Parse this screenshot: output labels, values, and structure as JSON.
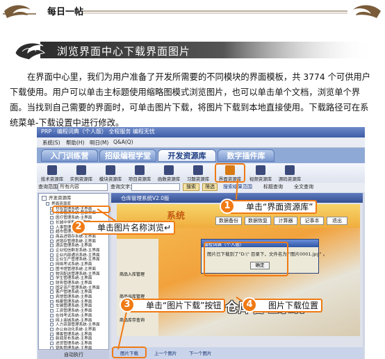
{
  "header": {
    "title": "每日一帖"
  },
  "banner": {
    "title": "浏览界面中心下载界面图片"
  },
  "paragraph": "在界面中心里，我们为用户准备了开发所需要的不同模块的界面模板，共 3774 个可供用户下载使用。用户可以单击主标题使用缩略图模式浏览图片，也可以单击单个文档，浏览单个界面。当找到自己需要的界面时，可单击图片下载，将图片下载到本地直接使用。下载路径可在系统菜单-下载设置中进行修改。",
  "screenshot": {
    "window_title": "PRP · 编程词典（个人版）   全程服务   编程无忧",
    "menus": [
      "系统(S)",
      "帮助(H)",
      "明日(M)",
      "Q&A(Q)"
    ],
    "tabs": [
      "入门训练营",
      "招级编程学堂",
      "开发资源库",
      "数字插件库"
    ],
    "active_tab": 2,
    "icons": [
      "技术资源库",
      "实例资源库",
      "模块资源库",
      "项目资源库",
      "函数资源库",
      "习题资源库",
      "界面资源库",
      "视频资源库",
      "源码资源库"
    ],
    "search": {
      "label1": "查询范围：",
      "scope": "所有内容",
      "label2": "查询文字：",
      "btn_search": "搜索",
      "btn_filter": "筛选",
      "opt1": "搜索结果范围",
      "opt2": "标题查询",
      "opt3": "全文查询"
    },
    "tree_root": "开发资源库",
    "tree_items": [
      "界面资源库",
      "仓库管理系统-主界面",
      "仓库管理系统-登录界面",
      "医疗管理系统-主界面",
      "长城中学教学资源网",
      "人事管理系统-主界面",
      "超市管理系统-登录界面",
      "商品进销存系统-主界面",
      "进销存管理系统-主界面",
      "酒店管理系统-主界面",
      "企业短信群发系统-主界面",
      "企业内部通讯系统-主界面",
      "企业生产管理系统-主界面",
      "网络考试系统-主界面",
      "图书馆管理系统-主界面",
      "物流配送管理系统-主界面",
      "学生管理系统-主界面",
      "财务管理系统-主界面",
      "固定资产管理系统-主界面",
      "客户管理系统-主界面",
      "宾馆管理系统-主界面",
      "档案管理系统-主界面",
      "车辆管理系统-主界面",
      "工资管理系统-主界面",
      "在线考试系统-主界面",
      "网上商城系统-主界面",
      "人力资源管理系统-主界面",
      "办公自动化系统-主界面",
      "博客管理系统-主界面",
      "新闻发布系统-主界面",
      "进货管理系统-主界面",
      "销售管理系统-主界面"
    ],
    "tree_footer": "自动执行",
    "main_title": "仓库管理系统V2.0版",
    "app_tabs": [
      "数据备份",
      "数据恢复",
      "计算器",
      "记事本",
      "退出"
    ],
    "app_left": [
      "商品入库管理",
      "商品出库管理",
      "商品库存查询"
    ],
    "app_logo": "仓库管理系统",
    "app_banner_text": "系统",
    "dialog": {
      "title": "编程词典（个人版）",
      "message": "图片已下载到了\"D:\\\" 目录下，文件名为 \"图片0001.jpg\" 。",
      "ok": "确定"
    },
    "bottom_buttons": [
      "图片下载",
      "上一个图片",
      "下一个图片"
    ]
  },
  "callouts": [
    {
      "num": "1",
      "text": "单击“界面资源库”"
    },
    {
      "num": "2",
      "text": "单击图片名称浏览↵"
    },
    {
      "num": "3",
      "text": "单击“图片下载”按钮"
    },
    {
      "num": "4",
      "text": "图片下载位置"
    }
  ],
  "colors": {
    "accent": "#f07a14",
    "banner_dark": "#3e3e3e",
    "ribbon_brown": "#7a5c3a"
  }
}
